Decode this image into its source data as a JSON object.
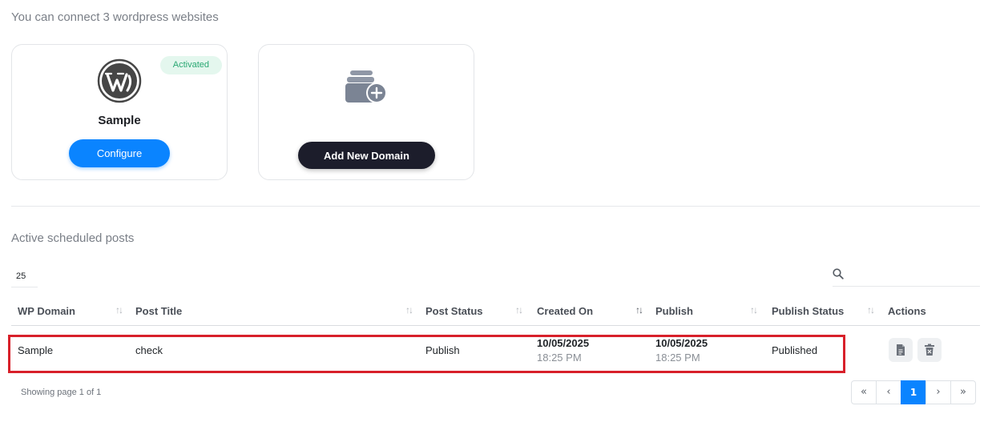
{
  "intro_text": "You can connect 3 wordpress websites",
  "site_card": {
    "badge": "Activated",
    "name": "Sample",
    "configure_label": "Configure",
    "logo_icon": "wordpress-logo-icon"
  },
  "add_card": {
    "icon": "folder-add-icon",
    "button_label": "Add New Domain"
  },
  "section_title": "Active scheduled posts",
  "table": {
    "page_size": "25",
    "search_placeholder": "",
    "columns": [
      "WP Domain",
      "Post Title",
      "Post Status",
      "Created On",
      "Publish",
      "Publish Status",
      "Actions"
    ],
    "rows": [
      {
        "wp_domain": "Sample",
        "post_title": "check",
        "post_status": "Publish",
        "created_date": "10/05/2025",
        "created_time": "18:25 PM",
        "publish_date": "10/05/2025",
        "publish_time": "18:25 PM",
        "publish_status": "Published",
        "actions": [
          "document-icon",
          "trash-icon"
        ]
      }
    ]
  },
  "footer": {
    "showing": "Showing page 1 of 1",
    "pager": [
      "«",
      "‹",
      "1",
      "›",
      "»"
    ],
    "current_page": "1"
  },
  "colors": {
    "primary": "#0a84ff",
    "dark_button": "#1c1d2b",
    "badge_bg": "#e4f7ee",
    "badge_text": "#2aa873",
    "highlight": "#d8202a"
  }
}
